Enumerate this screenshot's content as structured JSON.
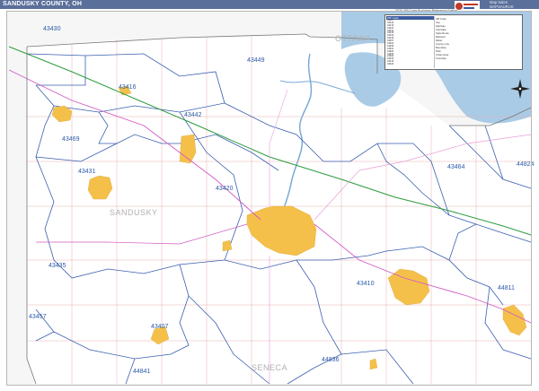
{
  "title": "SANDUSKY COUNTY, OH",
  "brand": {
    "name": "Map Sales",
    "sub": "MAPSAURUS"
  },
  "edition": "2020 ZIP Code Business Reference Edition",
  "legend": {
    "header": "ZIP Code",
    "rows": [
      "43407",
      "43410",
      "43416",
      "43420",
      "43431",
      "43435",
      "43442",
      "43449",
      "43457",
      "43464",
      "43469",
      "44811",
      "44824",
      "44836",
      "44841",
      "43430",
      "43416",
      "43420",
      "43431",
      "43442",
      "43449",
      "43464"
    ],
    "keys": [
      "ZIP Code",
      "City",
      "Highway",
      "Interstate",
      "State Route",
      "Railroad",
      "Water",
      "County Line",
      "Boundary",
      "Park",
      "Urban Area",
      "Township"
    ]
  },
  "colors": {
    "water": "#a9cbe6",
    "urban": "#f5c04a",
    "zip_boundary": "#3a5fb0",
    "interstate": "#2c9c3c",
    "highway": "#d05ac5",
    "road": "#e8b0b0"
  },
  "zips": [
    {
      "code": "43430",
      "label": "43430"
    },
    {
      "code": "43449",
      "label": "43449"
    },
    {
      "code": "43416",
      "label": "43416"
    },
    {
      "code": "43442",
      "label": "43442"
    },
    {
      "code": "43469",
      "label": "43469"
    },
    {
      "code": "43431",
      "label": "43431"
    },
    {
      "code": "43420",
      "label": "43420"
    },
    {
      "code": "43464",
      "label": "43464"
    },
    {
      "code": "44824",
      "label": "44824"
    },
    {
      "code": "43435",
      "label": "43435"
    },
    {
      "code": "43410",
      "label": "43410"
    },
    {
      "code": "44811",
      "label": "44811"
    },
    {
      "code": "43457",
      "label": "43457"
    },
    {
      "code": "43407",
      "label": "43407"
    },
    {
      "code": "44841",
      "label": "44841"
    },
    {
      "code": "44836",
      "label": "44836"
    }
  ],
  "counties": [
    "OTTAWA",
    "SANDUSKY",
    "SENECA"
  ]
}
